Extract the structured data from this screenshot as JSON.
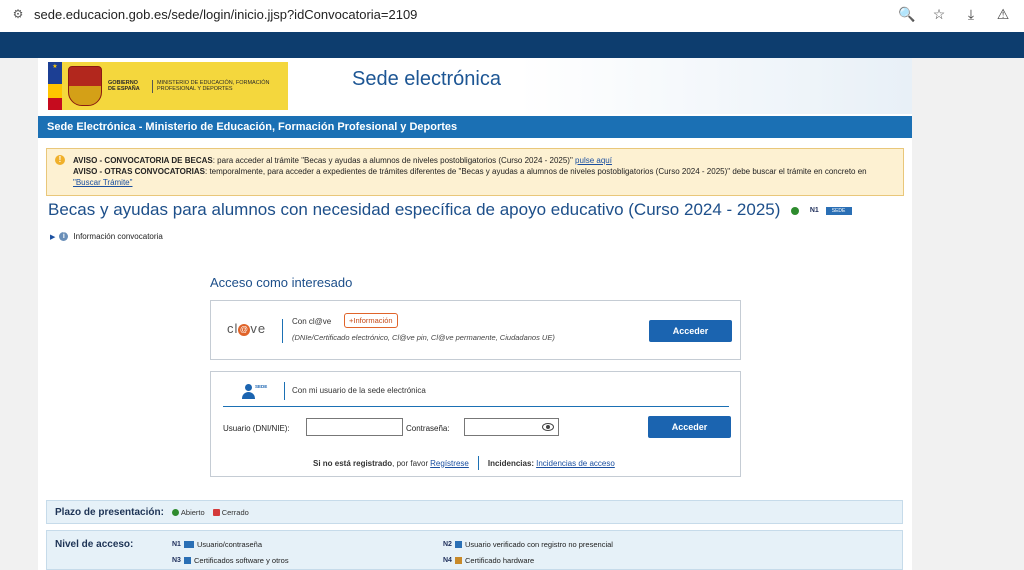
{
  "browser": {
    "url": "sede.educacion.gob.es/sede/login/inicio.jjsp?idConvocatoria=2109"
  },
  "header": {
    "logo_gobierno": "GOBIERNO DE ESPAÑA",
    "logo_ministerio": "MINISTERIO DE EDUCACIÓN, FORMACIÓN PROFESIONAL Y DEPORTES",
    "site_title": "Sede electrónica",
    "bar_title": "Sede Electrónica - Ministerio de Educación, Formación Profesional y Deportes"
  },
  "notice": {
    "line1_bold": "AVISO - CONVOCATORIA DE BECAS",
    "line1_text": ": para acceder al trámite \"Becas y ayudas a alumnos de niveles postobligatorios (Curso 2024 - 2025)\"",
    "line1_link": "pulse aquí",
    "line2_bold": "AVISO - OTRAS CONVOCATORIAS",
    "line2_text": ": temporalmente, para acceder a expedientes de trámites diferentes de \"Becas y ayudas a alumnos de niveles postobligatorios (Curso 2024 - 2025)\" debe buscar el trámite en concreto en",
    "line2_link": "\"Buscar Trámite\""
  },
  "procedure": {
    "title": "Becas y ayudas para alumnos con necesidad específica de apoyo educativo (Curso 2024 - 2025)",
    "level": "N1",
    "info_link": "Información convocatoria"
  },
  "access": {
    "title": "Acceso como interesado",
    "clave_logo": "cl@ve",
    "clave_label": "Con cl@ve",
    "clave_more": "+Información",
    "clave_desc": "(DNIe/Certificado electrónico, Cl@ve pin, Cl@ve permanente, Ciudadanos UE)",
    "clave_button": "Acceder",
    "sede_badge": "SEDE",
    "user_label": "Con mi usuario de la sede electrónica",
    "user_field_label": "Usuario (DNI/NIE):",
    "pass_field_label": "Contraseña:",
    "user_button": "Acceder",
    "not_registered": "Si no está registrado",
    "please": ", por favor",
    "register_link": "Regístrese",
    "incidencias_label": "Incidencias:",
    "incidencias_link": "Incidencias de acceso"
  },
  "plazo": {
    "title": "Plazo de presentación:",
    "open": "Abierto",
    "closed": "Cerrado"
  },
  "nivel": {
    "title": "Nivel de acceso:",
    "n1_code": "N1",
    "n1": "Usuario/contraseña",
    "n2_code": "N2",
    "n2": "Usuario verificado con registro no presencial",
    "n3_code": "N3",
    "n3": "Certificados software y otros",
    "n4_code": "N4",
    "n4": "Certificado hardware"
  },
  "colors": {
    "top_band": "#0d3d6e",
    "title_bar": "#1b70b4",
    "button": "#1b64b0",
    "notice_bg": "#fdf1d2"
  }
}
